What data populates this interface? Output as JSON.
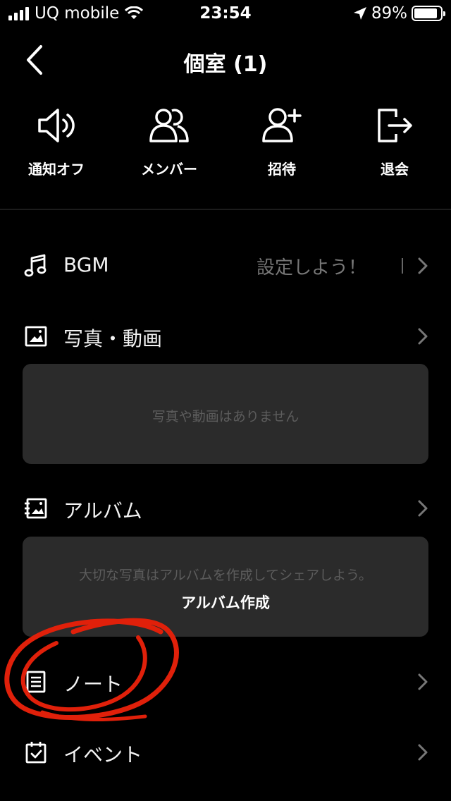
{
  "status_bar": {
    "carrier": "UQ mobile",
    "time": "23:54",
    "battery": "89%",
    "battery_level": 0.89
  },
  "header": {
    "title": "個室 (1)"
  },
  "actions": [
    {
      "label": "通知オフ",
      "icon": "speaker-icon"
    },
    {
      "label": "メンバー",
      "icon": "members-icon"
    },
    {
      "label": "招待",
      "icon": "add-user-icon"
    },
    {
      "label": "退会",
      "icon": "exit-icon"
    }
  ],
  "menu": {
    "bgm": {
      "label": "BGM",
      "hint": "設定しよう！"
    },
    "photos": {
      "label": "写真・動画",
      "empty_message": "写真や動画はありません"
    },
    "album": {
      "label": "アルバム",
      "message": "大切な写真はアルバムを作成してシェアしよう。",
      "create_label": "アルバム作成"
    },
    "note": {
      "label": "ノート"
    },
    "event": {
      "label": "イベント"
    }
  },
  "colors": {
    "background": "#000000",
    "card": "#2b2b2b",
    "annotation": "#e0200a"
  }
}
